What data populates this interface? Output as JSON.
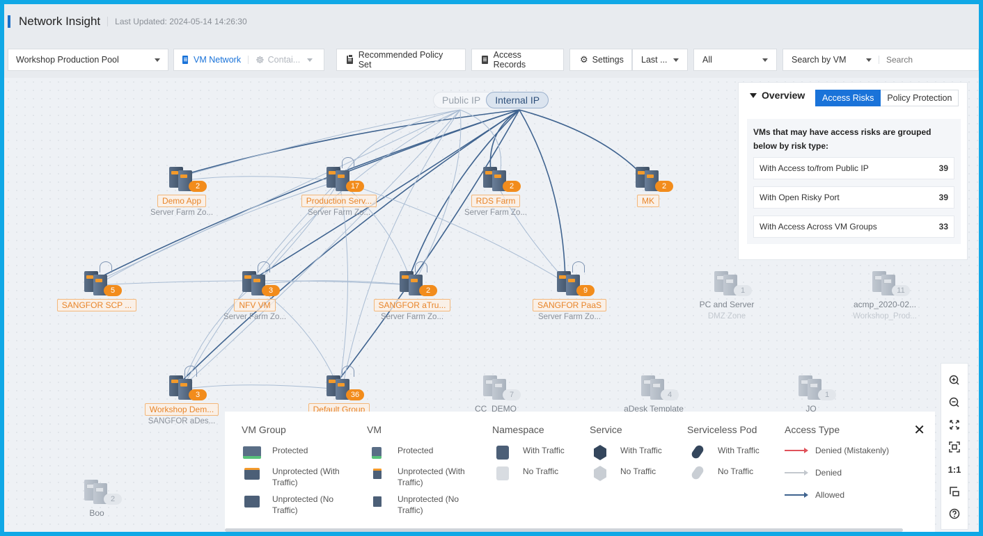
{
  "header": {
    "title": "Network Insight",
    "last_updated": "Last Updated: 2024-05-14 14:26:30"
  },
  "toolbar": {
    "pool_select": "Workshop Production Pool",
    "vm_network": "VM Network",
    "container": "Contai...",
    "recommended_policy": "Recommended Policy Set",
    "access_records": "Access Records",
    "settings": "Settings",
    "time_select": "Last ...",
    "filter_select": "All",
    "search_by": "Search by VM",
    "search_placeholder": "Search"
  },
  "ip_toggle": {
    "public": "Public IP",
    "internal": "Internal IP",
    "selected": "Internal IP"
  },
  "nodes": [
    {
      "name": "Demo App",
      "sub": "Server Farm Zo...",
      "count": "2",
      "active": true
    },
    {
      "name": "Production Serv...",
      "sub": "Server Farm Zo...",
      "count": "17",
      "active": true
    },
    {
      "name": "RDS Farm",
      "sub": "Server Farm Zo...",
      "count": "2",
      "active": true
    },
    {
      "name": "MK",
      "sub": "",
      "count": "2",
      "active": true
    },
    {
      "name": "SANGFOR SCP ...",
      "sub": "",
      "count": "5",
      "active": true
    },
    {
      "name": "NFV VM",
      "sub": "Server Farm Zo...",
      "count": "3",
      "active": true
    },
    {
      "name": "SANGFOR aTru...",
      "sub": "Server Farm Zo...",
      "count": "2",
      "active": true
    },
    {
      "name": "SANGFOR PaaS",
      "sub": "Server Farm Zo...",
      "count": "9",
      "active": true
    },
    {
      "name": "PC and Server",
      "sub": "DMZ Zone",
      "count": "1",
      "active": false
    },
    {
      "name": "acmp_2020-02...",
      "sub": "Workshop_Prod...",
      "count": "11",
      "active": false
    },
    {
      "name": "Workshop Dem...",
      "sub": "SANGFOR aDes...",
      "count": "3",
      "active": true
    },
    {
      "name": "Default Group",
      "sub": "",
      "count": "36",
      "active": true
    },
    {
      "name": "CC_DEMO",
      "sub": "",
      "count": "7",
      "active": false
    },
    {
      "name": "aDesk Template",
      "sub": "",
      "count": "4",
      "active": false
    },
    {
      "name": "JO",
      "sub": "",
      "count": "1",
      "active": false
    },
    {
      "name": "Boo",
      "sub": "",
      "count": "2",
      "active": false
    }
  ],
  "overview": {
    "title": "Overview",
    "tabs": [
      "Access Risks",
      "Policy Protection"
    ],
    "active_tab": "Access Risks",
    "description": "VMs that may have access risks are grouped below by risk type:",
    "risks": [
      {
        "label": "With Access to/from Public IP",
        "count": "39"
      },
      {
        "label": "With Open Risky Port",
        "count": "39"
      },
      {
        "label": "With Access Across VM Groups",
        "count": "33"
      }
    ]
  },
  "legend": {
    "vm_group": {
      "title": "VM Group",
      "items": [
        "Protected",
        "Unprotected (With Traffic)",
        "Unprotected (No Traffic)"
      ]
    },
    "vm": {
      "title": "VM",
      "items": [
        "Protected",
        "Unprotected (With Traffic)",
        "Unprotected (No Traffic)"
      ]
    },
    "namespace": {
      "title": "Namespace",
      "items": [
        "With Traffic",
        "No Traffic"
      ]
    },
    "service": {
      "title": "Service",
      "items": [
        "With Traffic",
        "No Traffic"
      ]
    },
    "serviceless_pod": {
      "title": "Serviceless Pod",
      "items": [
        "With Traffic",
        "No Traffic"
      ]
    },
    "access_type": {
      "title": "Access Type",
      "items": [
        {
          "label": "Denied (Mistakenly)",
          "color": "#e0525a"
        },
        {
          "label": "Denied",
          "color": "#c3c8ce"
        },
        {
          "label": "Allowed",
          "color": "#3f638f"
        }
      ]
    }
  },
  "zoom_controls": {
    "one_to_one": "1:1"
  },
  "colors": {
    "accent": "#1a73d9",
    "node_badge": "#f28c1c",
    "allowed_link": "#3f638f",
    "faint_link": "#a9bcd3",
    "frame": "#10a8e6"
  }
}
